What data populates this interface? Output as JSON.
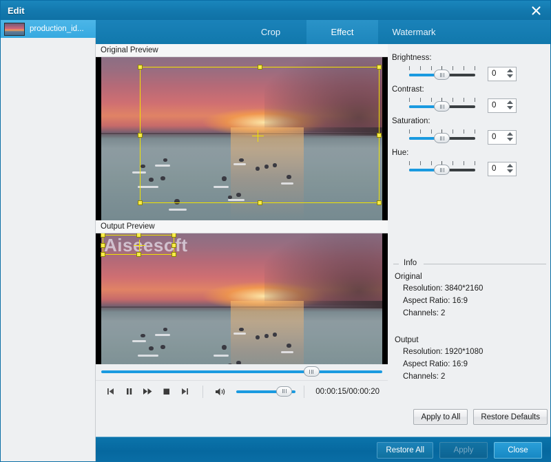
{
  "window": {
    "title": "Edit",
    "close_icon": "close-x-icon"
  },
  "sidebar": {
    "files": [
      {
        "name": "production_id...",
        "selected": true
      }
    ]
  },
  "tabs": [
    {
      "label": "Crop",
      "active": false
    },
    {
      "label": "Effect",
      "active": true
    },
    {
      "label": "Watermark",
      "active": false
    }
  ],
  "preview": {
    "original_label": "Original Preview",
    "output_label": "Output Preview",
    "watermark_text": "Aiseesoft"
  },
  "transport": {
    "previous_icon": "skip-previous-icon",
    "pause_icon": "pause-icon",
    "forward_icon": "fast-forward-icon",
    "stop_icon": "stop-icon",
    "next_icon": "skip-next-icon",
    "volume_icon": "volume-speaker-icon",
    "timecode": "00:00:15/00:00:20",
    "seek_position_pct": 72,
    "volume_position_pct": 68
  },
  "effects": {
    "controls": [
      {
        "label": "Brightness:",
        "value": "0",
        "slider_pct": 44
      },
      {
        "label": "Contrast:",
        "value": "0",
        "slider_pct": 44
      },
      {
        "label": "Saturation:",
        "value": "0",
        "slider_pct": 44
      },
      {
        "label": "Hue:",
        "value": "0",
        "slider_pct": 44
      }
    ]
  },
  "info": {
    "legend": "Info",
    "original_head": "Original",
    "original": [
      "Resolution: 3840*2160",
      "Aspect Ratio: 16:9",
      "Channels: 2"
    ],
    "output_head": "Output",
    "output": [
      "Resolution: 1920*1080",
      "Aspect Ratio: 16:9",
      "Channels: 2"
    ]
  },
  "panel_buttons": {
    "apply_to_all": "Apply to All",
    "restore_defaults": "Restore Defaults"
  },
  "footer": {
    "restore_all": "Restore All",
    "apply": "Apply",
    "close": "Close"
  },
  "colors": {
    "title_blue": "#1379ae",
    "footer_blue": "#06689f",
    "accent_blue": "#1a9ae0",
    "selection_blue": "#36a9e0",
    "crop_yellow": "#f2e400",
    "panel_gray": "#eef0f2"
  }
}
